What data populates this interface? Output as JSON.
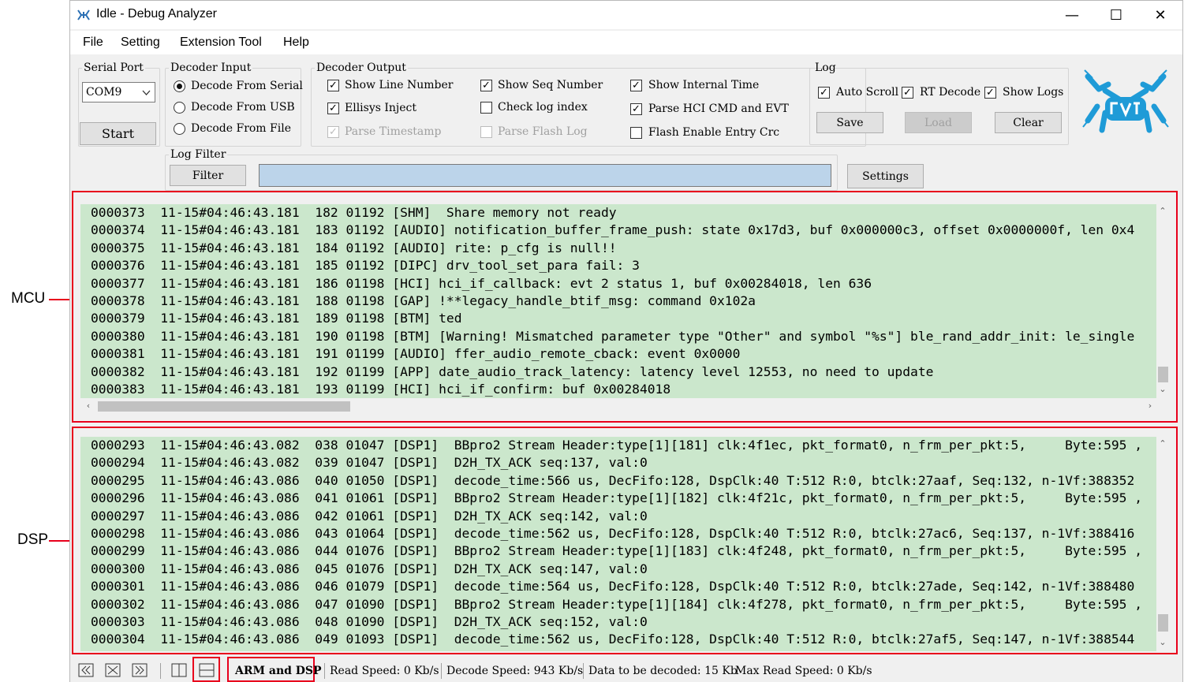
{
  "window": {
    "title": "Idle - Debug Analyzer",
    "controls": {
      "minimize": "—",
      "maximize": "☐",
      "close": "✕"
    }
  },
  "menu": [
    "File",
    "Setting",
    "Extension Tool",
    "Help"
  ],
  "serial_port": {
    "legend": "Serial Port",
    "selected": "COM9",
    "start_label": "Start"
  },
  "decoder_input": {
    "legend": "Decoder Input",
    "options": [
      "Decode From Serial",
      "Decode From USB",
      "Decode From File"
    ],
    "selected_index": 0
  },
  "decoder_output": {
    "legend": "Decoder Output",
    "options": [
      {
        "label": "Show Line Number",
        "checked": true,
        "enabled": true
      },
      {
        "label": "Ellisys Inject",
        "checked": true,
        "enabled": true
      },
      {
        "label": "Parse Timestamp",
        "checked": true,
        "enabled": false
      },
      {
        "label": "Show Seq Number",
        "checked": true,
        "enabled": true
      },
      {
        "label": "Check log index",
        "checked": false,
        "enabled": true
      },
      {
        "label": "Parse Flash Log",
        "checked": false,
        "enabled": false
      },
      {
        "label": "Show Internal Time",
        "checked": true,
        "enabled": true
      },
      {
        "label": "Parse HCI CMD and EVT",
        "checked": true,
        "enabled": true
      },
      {
        "label": "Flash Enable Entry Crc",
        "checked": false,
        "enabled": true
      }
    ]
  },
  "log_group": {
    "legend": "Log",
    "options": [
      {
        "label": "Auto Scroll",
        "checked": true
      },
      {
        "label": "RT Decode",
        "checked": true
      },
      {
        "label": "Show Logs",
        "checked": true
      }
    ],
    "buttons": {
      "save": "Save",
      "load": "Load",
      "clear": "Clear"
    }
  },
  "log_filter": {
    "legend": "Log Filter",
    "filter_button": "Filter",
    "filter_value": "",
    "settings_button": "Settings"
  },
  "mcu_label": "MCU",
  "dsp_label": "DSP",
  "mcu_log": [
    "0000373  11-15#04:46:43.181  182 01192 [SHM]  Share memory not ready",
    "0000374  11-15#04:46:43.181  183 01192 [AUDIO] notification_buffer_frame_push: state 0x17d3, buf 0x000000c3, offset 0x0000000f, len 0x4",
    "0000375  11-15#04:46:43.181  184 01192 [AUDIO] rite: p_cfg is null!!",
    "0000376  11-15#04:46:43.181  185 01192 [DIPC] drv_tool_set_para fail: 3",
    "0000377  11-15#04:46:43.181  186 01198 [HCI] hci_if_callback: evt 2 status 1, buf 0x00284018, len 636",
    "0000378  11-15#04:46:43.181  188 01198 [GAP] !**legacy_handle_btif_msg: command 0x102a",
    "0000379  11-15#04:46:43.181  189 01198 [BTM] ted",
    "0000380  11-15#04:46:43.181  190 01198 [BTM] [Warning! Mismatched parameter type \"Other\" and symbol \"%s\"] ble_rand_addr_init: le_single",
    "0000381  11-15#04:46:43.181  191 01199 [AUDIO] ffer_audio_remote_cback: event 0x0000",
    "0000382  11-15#04:46:43.181  192 01199 [APP] date_audio_track_latency: latency level 12553, no need to update",
    "0000383  11-15#04:46:43.181  193 01199 [HCI] hci_if_confirm: buf 0x00284018"
  ],
  "dsp_log": [
    "0000293  11-15#04:46:43.082  038 01047 [DSP1]  BBpro2 Stream Header:type[1][181] clk:4f1ec, pkt_format0, n_frm_per_pkt:5,     Byte:595 ,",
    "0000294  11-15#04:46:43.082  039 01047 [DSP1]  D2H_TX_ACK seq:137, val:0",
    "0000295  11-15#04:46:43.086  040 01050 [DSP1]  decode_time:566 us, DecFifo:128, DspClk:40 T:512 R:0, btclk:27aaf, Seq:132, n-1Vf:388352",
    "0000296  11-15#04:46:43.086  041 01061 [DSP1]  BBpro2 Stream Header:type[1][182] clk:4f21c, pkt_format0, n_frm_per_pkt:5,     Byte:595 ,",
    "0000297  11-15#04:46:43.086  042 01061 [DSP1]  D2H_TX_ACK seq:142, val:0",
    "0000298  11-15#04:46:43.086  043 01064 [DSP1]  decode_time:562 us, DecFifo:128, DspClk:40 T:512 R:0, btclk:27ac6, Seq:137, n-1Vf:388416",
    "0000299  11-15#04:46:43.086  044 01076 [DSP1]  BBpro2 Stream Header:type[1][183] clk:4f248, pkt_format0, n_frm_per_pkt:5,     Byte:595 ,",
    "0000300  11-15#04:46:43.086  045 01076 [DSP1]  D2H_TX_ACK seq:147, val:0",
    "0000301  11-15#04:46:43.086  046 01079 [DSP1]  decode_time:564 us, DecFifo:128, DspClk:40 T:512 R:0, btclk:27ade, Seq:142, n-1Vf:388480",
    "0000302  11-15#04:46:43.086  047 01090 [DSP1]  BBpro2 Stream Header:type[1][184] clk:4f278, pkt_format0, n_frm_per_pkt:5,     Byte:595 ,",
    "0000303  11-15#04:46:43.086  048 01090 [DSP1]  D2H_TX_ACK seq:152, val:0",
    "0000304  11-15#04:46:43.086  049 01093 [DSP1]  decode_time:562 us, DecFifo:128, DspClk:40 T:512 R:0, btclk:27af5, Seq:147, n-1Vf:388544"
  ],
  "status": {
    "mode": "ARM and DSP",
    "read_speed": "Read Speed:  0 Kb/s",
    "decode_speed": "Decode Speed:  943 Kb/s",
    "data_to_decode": "Data to be decoded:  15 Kb",
    "max_read_speed": "Max Read Speed:  0 Kb/s"
  },
  "colors": {
    "log_bg": "#cbe7cc",
    "highlight_red": "#e8001c",
    "logo_blue": "#1f9bd7"
  }
}
